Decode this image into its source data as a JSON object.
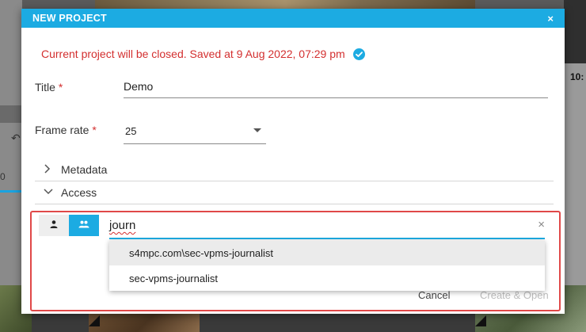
{
  "background": {
    "time_label": "10:"
  },
  "dialog": {
    "title": "NEW PROJECT",
    "close_glyph": "×",
    "notice": "Current project will be closed. Saved at 9 Aug 2022, 07:29 pm",
    "title_field": {
      "label": "Title",
      "required_mark": "*",
      "value": "Demo"
    },
    "frame_rate_field": {
      "label": "Frame rate",
      "required_mark": "*",
      "value": "25"
    },
    "sections": [
      {
        "label": "Metadata",
        "expanded": false
      },
      {
        "label": "Access",
        "expanded": true
      }
    ],
    "access": {
      "toggle_user_icon": "person-icon",
      "toggle_group_icon": "group-icon",
      "active_toggle": "group",
      "search_value": "journ",
      "clear_glyph": "×",
      "suggestions": [
        "s4mpc.com\\sec-vpms-journalist",
        "sec-vpms-journalist"
      ]
    },
    "buttons": {
      "cancel": "Cancel",
      "create_open": "Create & Open"
    }
  },
  "colors": {
    "accent": "#1cabe2",
    "error": "#d32f2f",
    "highlight_box": "#e04848"
  }
}
